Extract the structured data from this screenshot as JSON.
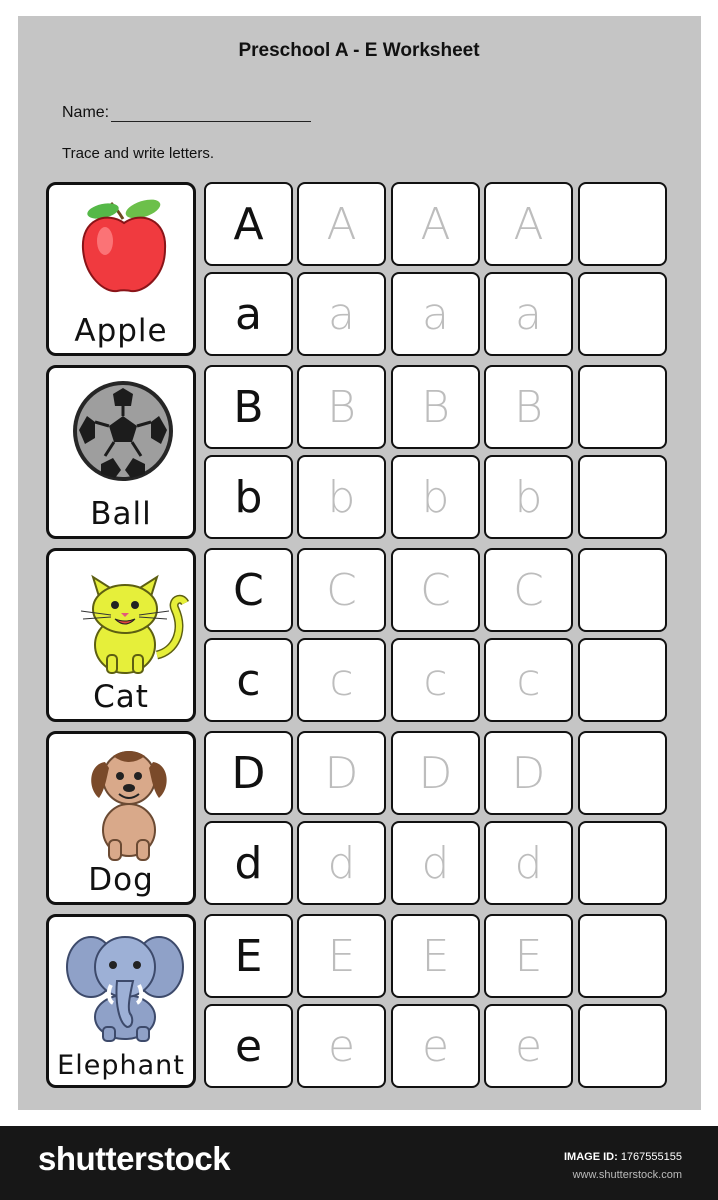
{
  "worksheet": {
    "title": "Preschool A - E Worksheet",
    "name_label": "Name:",
    "instruction": "Trace and write letters."
  },
  "rows": [
    {
      "word": "Apple",
      "upper": [
        "A",
        "A",
        "A",
        "A",
        ""
      ],
      "lower": [
        "a",
        "a",
        "a",
        "a",
        ""
      ]
    },
    {
      "word": "Ball",
      "upper": [
        "B",
        "B",
        "B",
        "B",
        ""
      ],
      "lower": [
        "b",
        "b",
        "b",
        "b",
        ""
      ]
    },
    {
      "word": "Cat",
      "upper": [
        "C",
        "C",
        "C",
        "C",
        ""
      ],
      "lower": [
        "c",
        "c",
        "c",
        "c",
        ""
      ]
    },
    {
      "word": "Dog",
      "upper": [
        "D",
        "D",
        "D",
        "D",
        ""
      ],
      "lower": [
        "d",
        "d",
        "d",
        "d",
        ""
      ]
    },
    {
      "word": "Elephant",
      "upper": [
        "E",
        "E",
        "E",
        "E",
        ""
      ],
      "lower": [
        "e",
        "e",
        "e",
        "e",
        ""
      ]
    }
  ],
  "footer": {
    "brand": "shutterstock",
    "image_id_label": "IMAGE ID:",
    "image_id": "1767555155",
    "site": "www.shutterstock.com"
  }
}
